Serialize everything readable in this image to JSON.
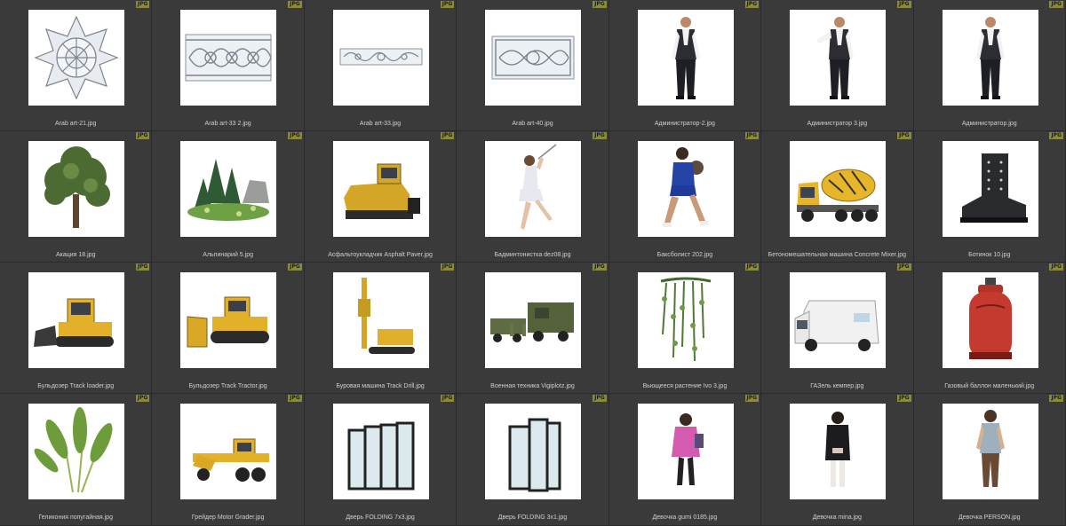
{
  "badge_label": "JPG",
  "files": [
    {
      "name": "Arab art-21.jpg",
      "icon": "arab-ornament-star"
    },
    {
      "name": "Arab art-33 2.jpg",
      "icon": "arab-ornament-frieze"
    },
    {
      "name": "Arab art-33.jpg",
      "icon": "arab-ornament-strip"
    },
    {
      "name": "Arab art-40.jpg",
      "icon": "arab-ornament-panel"
    },
    {
      "name": "Администратор-2.jpg",
      "icon": "man-standing"
    },
    {
      "name": "Администратор 3.jpg",
      "icon": "man-gesturing"
    },
    {
      "name": "Администратор.jpg",
      "icon": "man-standing"
    },
    {
      "name": "Акация 18.jpg",
      "icon": "tree"
    },
    {
      "name": "Альпинарий 5.jpg",
      "icon": "rock-garden"
    },
    {
      "name": "Асфальтоукладчик Asphalt Paver.jpg",
      "icon": "asphalt-paver"
    },
    {
      "name": "Бадминтонистка dez08.jpg",
      "icon": "badminton-player"
    },
    {
      "name": "Баксболист 202.jpg",
      "icon": "athlete"
    },
    {
      "name": "Бетономешательная машина Concrete Mixer.jpg",
      "icon": "concrete-mixer-truck"
    },
    {
      "name": "Ботинок 10.jpg",
      "icon": "boot"
    },
    {
      "name": "Бульдозер Track loader.jpg",
      "icon": "track-loader"
    },
    {
      "name": "Бульдозер Track Tractor.jpg",
      "icon": "bulldozer"
    },
    {
      "name": "Буровая машина Track Drill.jpg",
      "icon": "drill-rig"
    },
    {
      "name": "Военная техника Vigiplotz.jpg",
      "icon": "military-vehicles"
    },
    {
      "name": "Вьющееся растение Ivo 3.jpg",
      "icon": "hanging-plant"
    },
    {
      "name": "ГАЗель кемпер.jpg",
      "icon": "camper-van"
    },
    {
      "name": "Газовый баллон маленький.jpg",
      "icon": "gas-cylinder"
    },
    {
      "name": "Геликония попугайная.jpg",
      "icon": "heliconia-plant"
    },
    {
      "name": "Грейдер Motor Grader.jpg",
      "icon": "motor-grader"
    },
    {
      "name": "Дверь FOLDING 7x3.jpg",
      "icon": "folding-door-wide"
    },
    {
      "name": "Дверь FOLDING 3x1.jpg",
      "icon": "folding-door"
    },
    {
      "name": "Девочка gumi 0185.jpg",
      "icon": "girl-pink-jacket"
    },
    {
      "name": "Девочка mina.jpg",
      "icon": "girl-black-coat"
    },
    {
      "name": "Девочка PERSON.jpg",
      "icon": "girl-standing"
    }
  ]
}
